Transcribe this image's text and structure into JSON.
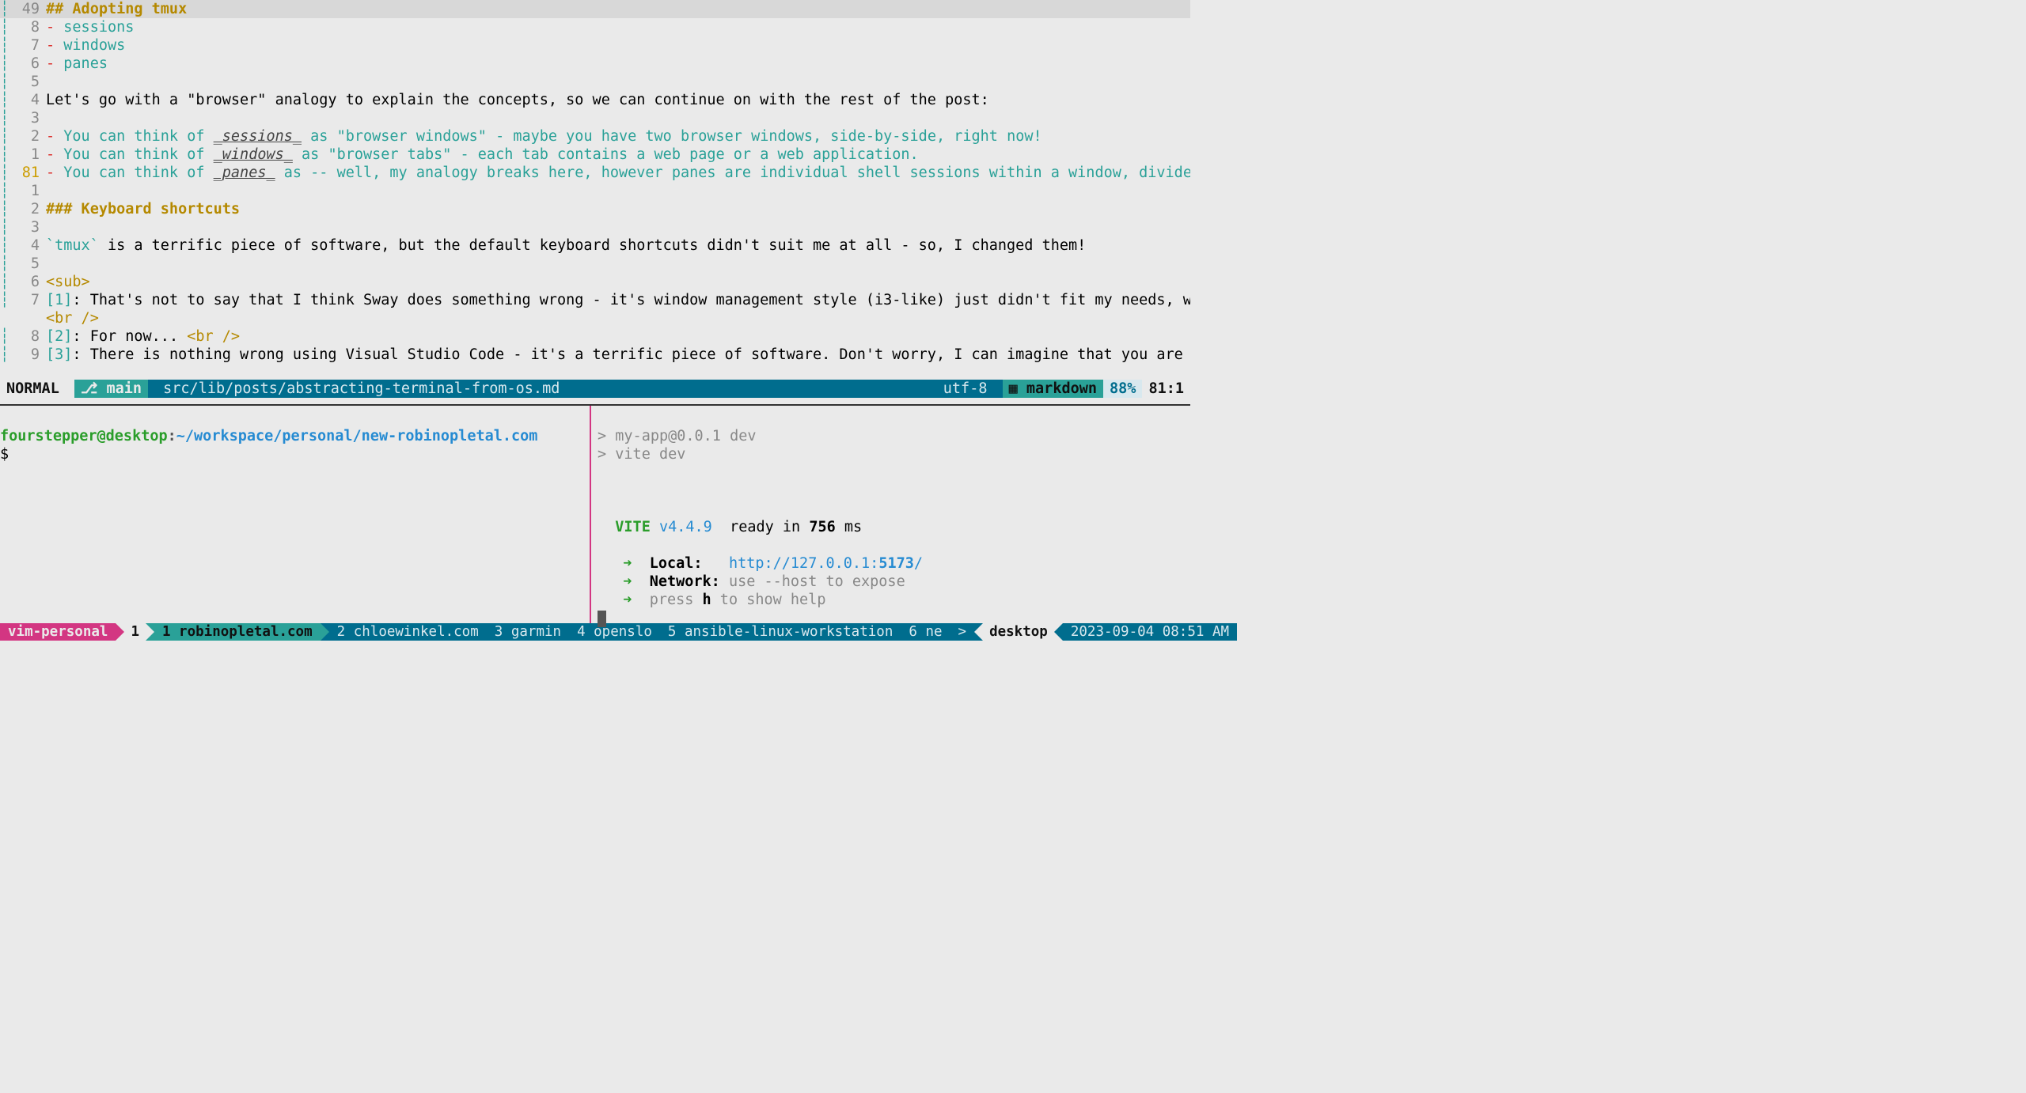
{
  "editor": {
    "lines": [
      {
        "n": "49",
        "cur": true,
        "segs": [
          {
            "c": "hdr",
            "t": "## Adopting tmux"
          }
        ]
      },
      {
        "n": "8",
        "segs": [
          {
            "c": "listOp",
            "t": "-"
          },
          {
            "t": " "
          },
          {
            "c": "listItem",
            "t": "sessions"
          }
        ]
      },
      {
        "n": "7",
        "segs": [
          {
            "c": "listOp",
            "t": "-"
          },
          {
            "t": " "
          },
          {
            "c": "listItem",
            "t": "windows"
          }
        ]
      },
      {
        "n": "6",
        "segs": [
          {
            "c": "listOp",
            "t": "-"
          },
          {
            "t": " "
          },
          {
            "c": "listItem",
            "t": "panes"
          }
        ]
      },
      {
        "n": "5",
        "segs": []
      },
      {
        "n": "4",
        "segs": [
          {
            "t": "Let's go with a \"browser\" analogy to explain the concepts, so we can continue on with the rest of the post:"
          }
        ]
      },
      {
        "n": "3",
        "segs": []
      },
      {
        "n": "2",
        "segs": [
          {
            "c": "listOp",
            "t": "-"
          },
          {
            "t": " "
          },
          {
            "c": "listItem",
            "t": "You can think of "
          },
          {
            "c": "em",
            "t": "_sessions_"
          },
          {
            "c": "listItem",
            "t": " as \"browser windows\" - maybe you have two browser windows, side-by-side, right now!"
          }
        ]
      },
      {
        "n": "1",
        "segs": [
          {
            "c": "listOp",
            "t": "-"
          },
          {
            "t": " "
          },
          {
            "c": "listItem",
            "t": "You can think of "
          },
          {
            "c": "em",
            "t": "_windows_"
          },
          {
            "c": "listItem",
            "t": " as \"browser tabs\" - each tab contains a web page or a web application."
          }
        ]
      },
      {
        "n": "81",
        "abs": true,
        "segs": [
          {
            "c": "listOp",
            "t": "-"
          },
          {
            "t": " "
          },
          {
            "c": "listItem",
            "t": "You can think of "
          },
          {
            "c": "em",
            "t": "_panes_"
          },
          {
            "c": "listItem",
            "t": " as -- well, my analogy breaks here, however panes are individual shell sessions within a window, divided visually."
          }
        ]
      },
      {
        "n": "1",
        "segs": []
      },
      {
        "n": "2",
        "segs": [
          {
            "c": "hdr",
            "t": "### Keyboard shortcuts"
          }
        ]
      },
      {
        "n": "3",
        "segs": []
      },
      {
        "n": "4",
        "segs": [
          {
            "c": "code",
            "t": "`tmux`"
          },
          {
            "t": " is a terrific piece of software, but the default keyboard shortcuts didn't suit me at all - so, I changed them!"
          }
        ]
      },
      {
        "n": "5",
        "segs": []
      },
      {
        "n": "6",
        "segs": [
          {
            "c": "tag",
            "t": "<sub>"
          }
        ]
      },
      {
        "n": "7",
        "segs": [
          {
            "c": "ref",
            "t": "[1]"
          },
          {
            "t": ": That's not to say that I think Sway does something wrong - it's window management style (i3-like) just didn't fit my needs, which is OK. "
          }
        ]
      },
      {
        "n": "",
        "cont": true,
        "segs": [
          {
            "c": "tag",
            "t": "<br />"
          }
        ]
      },
      {
        "n": "8",
        "segs": [
          {
            "c": "ref",
            "t": "[2]"
          },
          {
            "t": ": For now... "
          },
          {
            "c": "tag",
            "t": "<br />"
          }
        ]
      },
      {
        "n": "9",
        "segs": [
          {
            "c": "ref",
            "t": "[3]"
          },
          {
            "t": ": There is nothing wrong using Visual Studio Code - it's a terrific piece of software. Don't worry, I can imagine that you are also running"
          }
        ]
      }
    ]
  },
  "status": {
    "mode": "NORMAL",
    "branch_icon": "⎇",
    "branch": "main",
    "path": "src/lib/posts/abstracting-terminal-from-os.md",
    "encoding": "utf-8",
    "filetype_icon": "▦",
    "filetype": "markdown",
    "percent": "88%",
    "position": "81:1"
  },
  "term_left": {
    "user": "fourstepper@desktop",
    "colon": ":",
    "path": "~/workspace/personal/new-robinopletal.com",
    "prompt": "$"
  },
  "term_right": {
    "l1": "> my-app@0.0.1 dev",
    "l2": "> vite dev",
    "vite": "VITE",
    "ver": "v4.4.9",
    "ready1": "  ready in ",
    "ms": "756",
    "ready2": " ms",
    "arrow": "➜",
    "local_lbl": "Local:",
    "local_url_a": "http://127.0.0.1:",
    "local_url_b": "5173",
    "local_url_c": "/",
    "net_lbl": "Network:",
    "net_txt": " use --host to expose",
    "help_a": "press ",
    "help_b": "h",
    "help_c": " to show help"
  },
  "tmux": {
    "session": "vim-personal",
    "session_index": "1",
    "active": "1 robinopletal.com",
    "windows": [
      "2 chloewinkel.com",
      "3 garmin",
      "4 openslo",
      "5 ansible-linux-workstation",
      "6 ne"
    ],
    "host_prefix": ">",
    "host": "desktop",
    "clock": "2023-09-04 08:51 AM"
  }
}
